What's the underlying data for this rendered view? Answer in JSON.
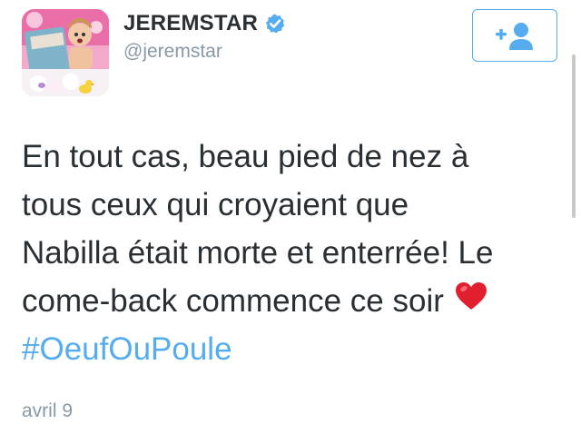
{
  "user": {
    "display_name": "JEREMSTAR",
    "handle": "@jeremstar",
    "verified": true,
    "avatar_icon": "profile-photo"
  },
  "follow_button": {
    "icon": "add-user-icon",
    "accent_color": "#55acee"
  },
  "tweet": {
    "lines": [
      "En tout cas, beau pied de nez à",
      "tous ceux qui croyaient que",
      "Nabilla était morte et enterrée! Le",
      "come-back commence ce soir"
    ],
    "emoji": "heart-emoji",
    "hashtag": "#OeufOuPoule",
    "timestamp": "avril 9"
  },
  "colors": {
    "text": "#292f33",
    "muted": "#8899a6",
    "link": "#55acee",
    "heart": "#e0202e"
  }
}
